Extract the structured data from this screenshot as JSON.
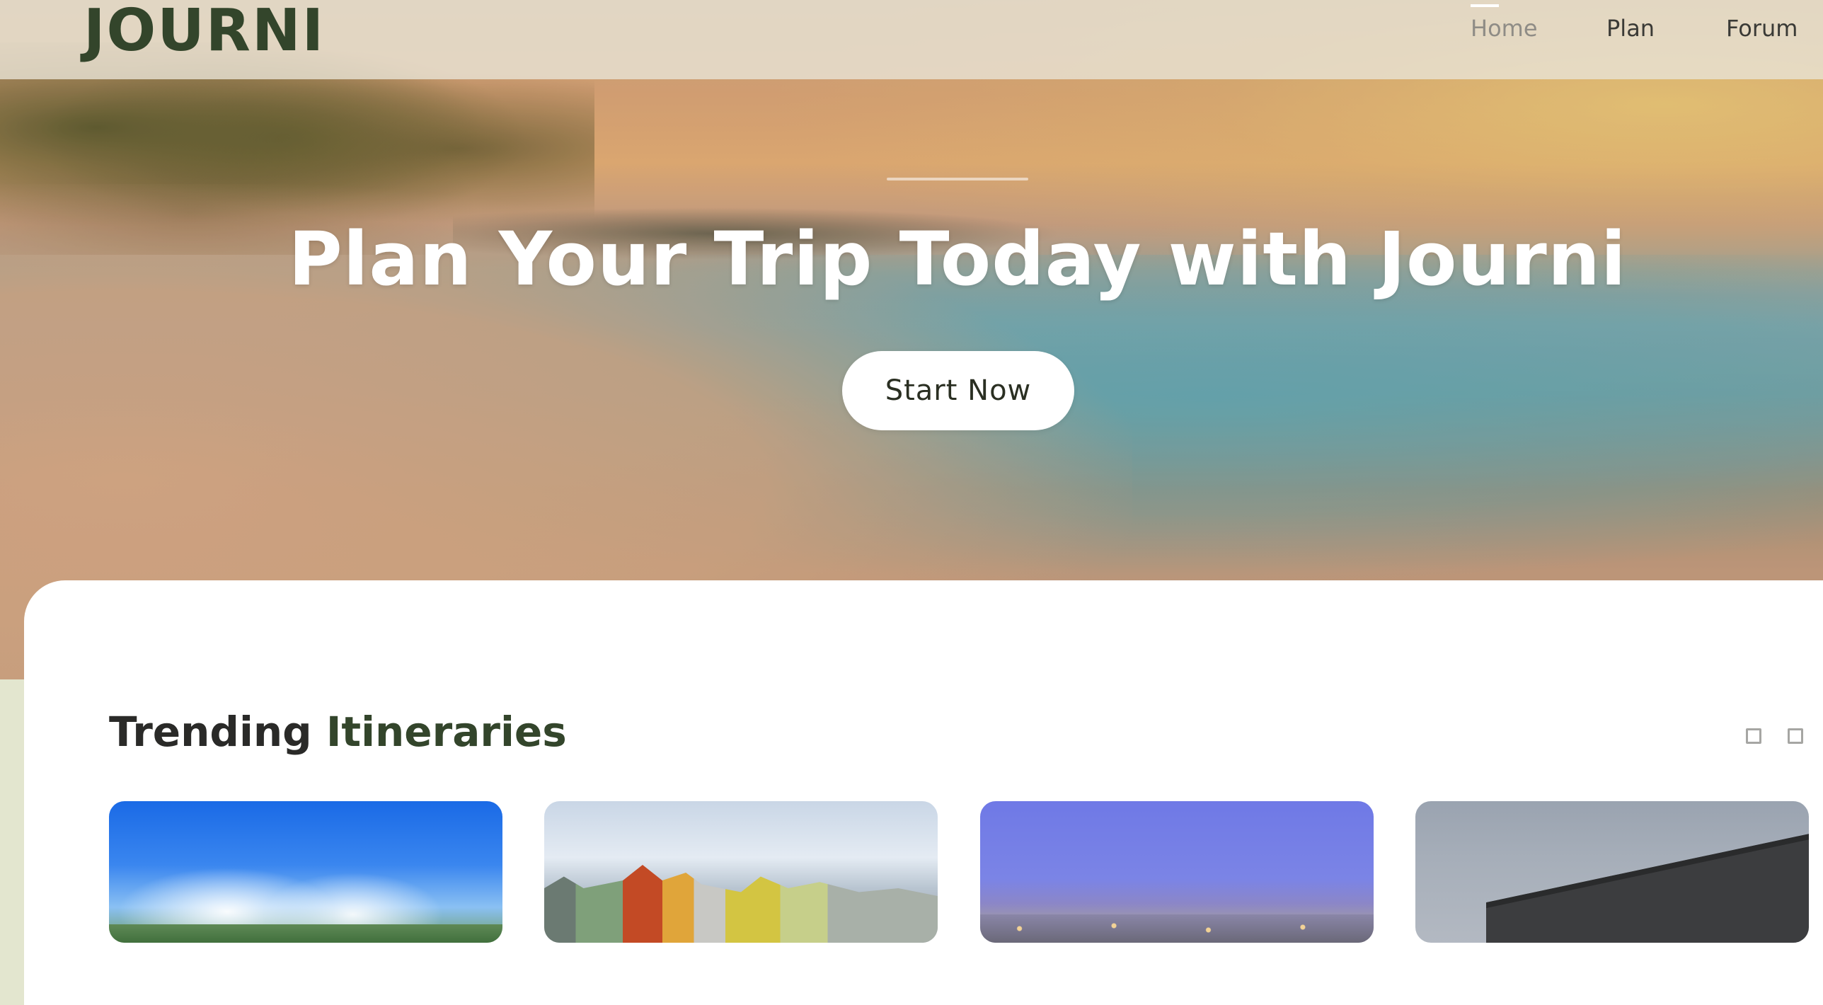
{
  "brand": {
    "logo": "JOURNI"
  },
  "nav": {
    "items": [
      {
        "label": "Home",
        "active": true
      },
      {
        "label": "Plan",
        "active": false
      },
      {
        "label": "Forum",
        "active": false
      }
    ]
  },
  "hero": {
    "title": "Plan Your Trip Today with Journi",
    "cta_label": "Start Now"
  },
  "trending": {
    "title_part1": "Trending ",
    "title_part2": "Itineraries",
    "cards": [
      {
        "image": "mountain-landscape-image"
      },
      {
        "image": "colorful-townhouses-image"
      },
      {
        "image": "city-dusk-image"
      },
      {
        "image": "modern-building-image"
      }
    ]
  },
  "colors": {
    "brand_green": "#33452b",
    "nav_active": "#8f8c86",
    "panel_bg": "#ffffff"
  }
}
